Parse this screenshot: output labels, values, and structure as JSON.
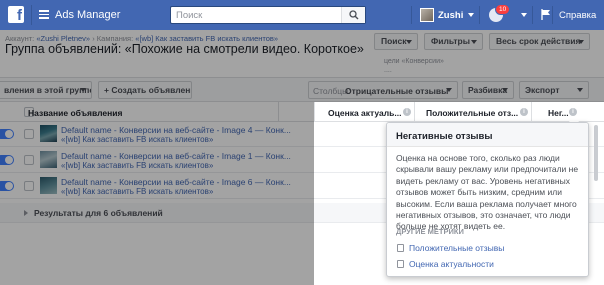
{
  "topbar": {
    "logo_letter": "f",
    "app_title": "Ads Manager",
    "search_placeholder": "Поиск",
    "user_name": "Zushi",
    "notification_count": "10",
    "help_label": "Справка",
    "brand_color": "#4267b2"
  },
  "header": {
    "breadcrumb_account_prefix": "Аккаунт: ",
    "breadcrumb_account": "«Zushi Pletnev»",
    "breadcrumb_sep": " › ",
    "breadcrumb_campaign_prefix": "Кампания: ",
    "breadcrumb_campaign": "«[wb] Как заставить FB искать клиентов»",
    "title": "Группа объявлений: «Похожие на смотрели видео. Короткое»",
    "search_button": "Поиск",
    "filters_button": "Фильтры",
    "date_range_button": "Весь срок действия",
    "right_note_line1": "цели «Конверсии»",
    "right_note_line2": "...."
  },
  "toolbar": {
    "group_ads_button": "вления в этой группе",
    "create_ad_button": "+ Создать объявление",
    "columns_label": "Столбцы:",
    "columns_value": "Отрицательные отзывы",
    "breakdown_button": "Разбивка",
    "export_button": "Экспорт"
  },
  "table": {
    "columns": {
      "ad_name": "Название объявления",
      "relevance": "Оценка актуаль...",
      "positive": "Положительные отз...",
      "negative": "Нег..."
    },
    "rows": [
      {
        "name": "Default name - Конверсии на веб-сайте - Image 4 — Конк...",
        "campaign": "«[wb] Как заставить FB искать клиентов»"
      },
      {
        "name": "Default name - Конверсии на веб-сайте - Image 1 — Конк...",
        "campaign": "«[wb] Как заставить FB искать клиентов»"
      },
      {
        "name": "Default name - Конверсии на веб-сайте - Image 6 — Конк...",
        "campaign": "«[wb] Как заставить FB искать клиентов»"
      }
    ],
    "results_label": "Результаты для 6 объявлений"
  },
  "tooltip": {
    "title": "Негативные отзывы",
    "body": "Оценка на основе того, сколько раз люди скрывали вашу рекламу или предпочитали не видеть рекламу от вас. Уровень негативных отзывов может быть низким, средним или высоким. Если ваша реклама получает много негативных отзывов, это означает, что люди больше не хотят видеть ее.",
    "other_metrics_label": "ДРУГИЕ МЕТРИКИ",
    "links": [
      "Положительные отзывы",
      "Оценка актуальности"
    ]
  }
}
